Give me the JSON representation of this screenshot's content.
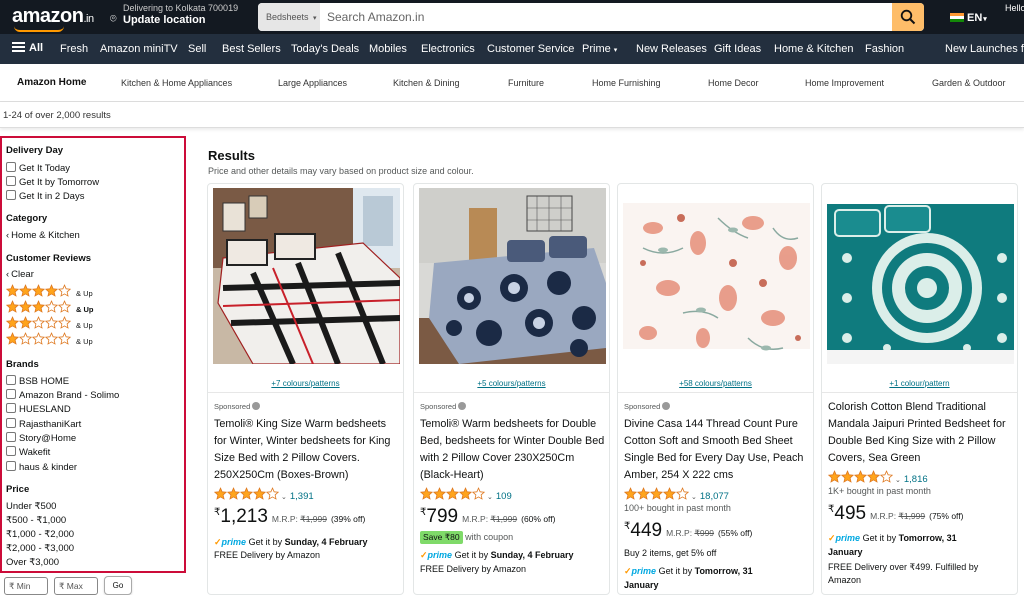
{
  "header": {
    "logo": "amazon",
    "logo_suffix": ".in",
    "deliver_line1": "Delivering to Kolkata 700019",
    "deliver_line2": "Update location",
    "search_category": "Bedsheets",
    "search_placeholder": "Search Amazon.in",
    "language": "EN",
    "hello": "Hello"
  },
  "nav": {
    "all": "All",
    "items": [
      "Fresh",
      "Amazon miniTV",
      "Sell",
      "Best Sellers",
      "Today's Deals",
      "Mobiles",
      "Electronics",
      "Customer Service",
      "Prime",
      "New Releases",
      "Gift Ideas",
      "Home & Kitchen",
      "Fashion",
      "New Launches fr"
    ]
  },
  "subnav": {
    "home": "Amazon Home",
    "items": [
      "Kitchen & Home Appliances",
      "Large Appliances",
      "Kitchen & Dining",
      "Furniture",
      "Home Furnishing",
      "Home Decor",
      "Home Improvement",
      "Garden & Outdoor"
    ]
  },
  "results_count": "1-24 of over 2,000 results",
  "filters": {
    "delivery_heading": "Delivery Day",
    "delivery": [
      "Get It Today",
      "Get It by Tomorrow",
      "Get It in 2 Days"
    ],
    "category_heading": "Category",
    "category": "Home & Kitchen",
    "reviews_heading": "Customer Reviews",
    "reviews_clear": "Clear",
    "reviews": [
      {
        "stars": 4,
        "label": "& Up"
      },
      {
        "stars": 3,
        "label": "& Up"
      },
      {
        "stars": 2,
        "label": "& Up"
      },
      {
        "stars": 1,
        "label": "& Up"
      }
    ],
    "brands_heading": "Brands",
    "brands": [
      "BSB HOME",
      "Amazon Brand - Solimo",
      "HUESLAND",
      "RajasthaniKart",
      "Story@Home",
      "Wakefit",
      "haus & kinder"
    ],
    "price_heading": "Price",
    "prices": [
      "Under ₹500",
      "₹500 - ₹1,000",
      "₹1,000 - ₹2,000",
      "₹2,000 - ₹3,000",
      "Over ₹3,000"
    ],
    "min_placeholder": "₹ Min",
    "max_placeholder": "₹ Max",
    "go": "Go"
  },
  "results": {
    "title": "Results",
    "subtitle": "Price and other details may vary based on product size and colour.",
    "products": [
      {
        "colours": "+7 colours/patterns",
        "sponsored": "Sponsored",
        "title": "Temoli® King Size Warm bedsheets for Winter, Winter bedsheets for King Size Bed with 2 Pillow Covers. 250X250Cm (Boxes-Brown)",
        "rating": 4,
        "reviews": "1,391",
        "bought": "",
        "currency": "₹",
        "price": "1,213",
        "mrp_label": "M.R.P:",
        "mrp": "₹1,999",
        "off": "(39% off)",
        "save_badge": "",
        "coupon": "",
        "prime": "prime",
        "delivery_pre": "Get it by",
        "delivery_date": "Sunday, 4 February",
        "free": "FREE Delivery by Amazon",
        "extra": ""
      },
      {
        "colours": "+5 colours/patterns",
        "sponsored": "Sponsored",
        "title": "Temoli® Warm bedsheets for Double Bed, bedsheets for Winter Double Bed with 2 Pillow Cover 230X250Cm (Black-Heart)",
        "rating": 4,
        "reviews": "109",
        "bought": "",
        "currency": "₹",
        "price": "799",
        "mrp_label": "M.R.P:",
        "mrp": "₹1,999",
        "off": "(60% off)",
        "save_badge": "Save ₹80",
        "coupon": "with coupon",
        "prime": "prime",
        "delivery_pre": "Get it by",
        "delivery_date": "Sunday, 4 February",
        "free": "FREE Delivery by Amazon",
        "extra": ""
      },
      {
        "colours": "+58 colours/patterns",
        "sponsored": "Sponsored",
        "title": "Divine Casa 144 Thread Count Pure Cotton Soft and Smooth Bed Sheet Single Bed for Every Day Use, Peach Amber, 254 X 222 cms",
        "rating": 4,
        "reviews": "18,077",
        "bought": "100+ bought in past month",
        "currency": "₹",
        "price": "449",
        "mrp_label": "M.R.P:",
        "mrp": "₹999",
        "off": "(55% off)",
        "save_badge": "",
        "coupon": "",
        "extra": "Buy 2 items, get 5% off",
        "prime": "prime",
        "delivery_pre": "Get it by",
        "delivery_date": "Tomorrow, 31",
        "delivery_date2": "January",
        "free": ""
      },
      {
        "colours": "+1 colour/pattern",
        "sponsored": "",
        "title": "Colorish Cotton Blend Traditional Mandala Jaipuri Printed Bedsheet for Double Bed King Size with 2 Pillow Covers, Sea Green",
        "rating": 4,
        "reviews": "1,816",
        "bought": "1K+ bought in past month",
        "currency": "₹",
        "price": "495",
        "mrp_label": "M.R.P:",
        "mrp": "₹1,999",
        "off": "(75% off)",
        "save_badge": "",
        "coupon": "",
        "extra": "",
        "prime": "prime",
        "delivery_pre": "Get it by",
        "delivery_date": "Tomorrow, 31",
        "delivery_date2": "January",
        "free": "FREE Delivery over ₹499. Fulfilled by Amazon"
      }
    ]
  },
  "colors": {
    "header_bg": "#131921",
    "nav_bg": "#232f3e",
    "search_button": "#febd69",
    "link": "#007185",
    "star": "#ffa41c",
    "highlight_border": "#cc0c39",
    "prime_blue": "#00a8e1"
  }
}
